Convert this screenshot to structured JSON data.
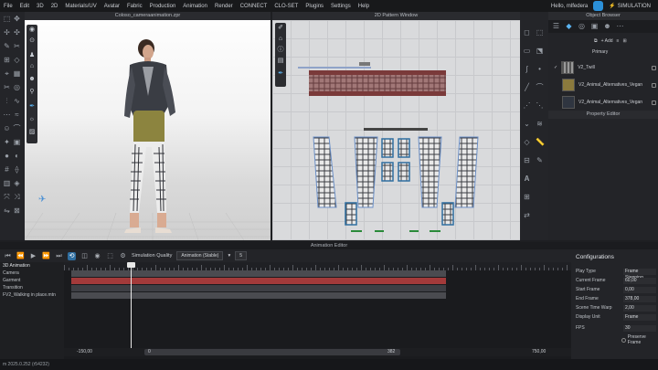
{
  "menu": [
    "File",
    "Edit",
    "3D",
    "2D",
    "Materials/UV",
    "Avatar",
    "Fabric",
    "Production",
    "Animation",
    "Render",
    "CONNECT",
    "CLO-SET",
    "Plugins",
    "Settings",
    "Help"
  ],
  "user": "Hello, mlfedera",
  "mode_label": "SIMULATION",
  "viewport3d_title": "Coloso_cameraanimation.zpr",
  "pattern_window_title": "2D Pattern Window",
  "object_browser": {
    "title": "Object Browser",
    "add_label": "+ Add",
    "section": "Primary",
    "items": [
      {
        "label": "V2_Twill",
        "color": "#6d6d6d"
      },
      {
        "label": "V2_Animal_Alternatives_Vegan",
        "color": "#8b7a3d"
      },
      {
        "label": "V2_Animal_Alternatives_Vegan",
        "color": "#2f3540"
      }
    ]
  },
  "property_editor_title": "Property Editor",
  "animation_editor_title": "Animation Editor",
  "anim_toolbar": {
    "sim_quality_label": "Simulation Quality",
    "sim_quality_value": "Animation (Stable)",
    "speed_value": "5"
  },
  "tracks": {
    "header": "3D Animation",
    "items": [
      "Camera",
      "Garment",
      "Transition",
      "FV2_Walking in place.mtn"
    ]
  },
  "scroll": {
    "left": "-150,00",
    "start": "0",
    "end": "382",
    "right": "750,00"
  },
  "config": {
    "title": "Configurations",
    "rows": [
      {
        "key": "Play Type",
        "value": "Frame Stepping"
      },
      {
        "key": "Current Frame",
        "value": "60,00"
      },
      {
        "key": "Start Frame",
        "value": "0,00"
      },
      {
        "key": "End Frame",
        "value": "378,00"
      },
      {
        "key": "Scene Time Warp",
        "value": "2,00"
      },
      {
        "key": "Display Unit",
        "value": "Frame"
      },
      {
        "key": "FPS",
        "value": "30"
      }
    ],
    "preserve_label": "Preserve Frame"
  },
  "status": "m 2025.0.252 (r54232)"
}
